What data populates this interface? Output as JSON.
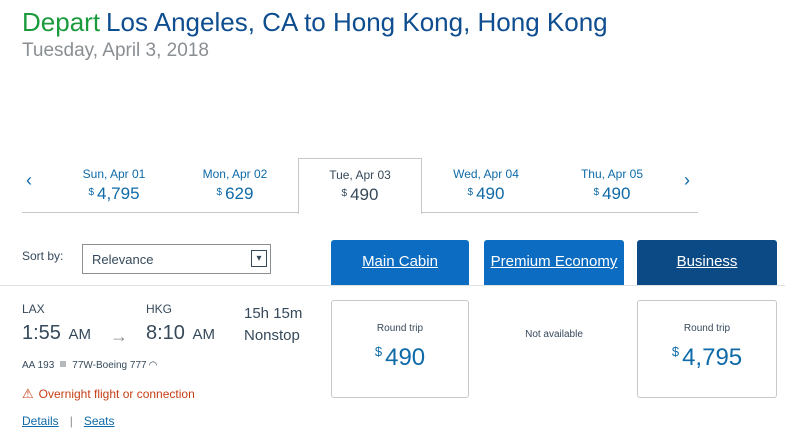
{
  "header": {
    "depart_label": "Depart",
    "route": "Los Angeles, CA to Hong Kong, Hong Kong",
    "date": "Tuesday, April 3, 2018"
  },
  "date_bar": {
    "prev_icon": "chevron-left-icon",
    "next_icon": "chevron-right-icon",
    "prev_glyph": "‹",
    "next_glyph": "›",
    "days": [
      {
        "label": "Sun, Apr 01",
        "currency": "$",
        "price": "4,795",
        "active": false
      },
      {
        "label": "Mon, Apr 02",
        "currency": "$",
        "price": "629",
        "active": false
      },
      {
        "label": "Tue, Apr 03",
        "currency": "$",
        "price": "490",
        "active": true
      },
      {
        "label": "Wed, Apr 04",
        "currency": "$",
        "price": "490",
        "active": false
      },
      {
        "label": "Thu, Apr 05",
        "currency": "$",
        "price": "490",
        "active": false
      }
    ]
  },
  "sort": {
    "label": "Sort by:",
    "selected": "Relevance",
    "dropdown_glyph": "▾"
  },
  "cabins": {
    "main": "Main Cabin",
    "premium": "Premium Economy",
    "business": "Business"
  },
  "flight": {
    "origin": "LAX",
    "destination": "HKG",
    "depart_time": "1:55",
    "depart_ampm": "AM",
    "arrive_time": "8:10",
    "arrive_ampm": "AM",
    "arrow_glyph": "→",
    "duration": "15h  15m",
    "stops": "Nonstop",
    "flight_number": "AA 193",
    "aircraft": "77W-Boeing 777",
    "wifi_glyph": "◠",
    "warning_glyph": "⚠",
    "warning": "Overnight flight or connection",
    "details_link": "Details",
    "seats_link": "Seats",
    "link_separator": "|"
  },
  "fares": {
    "main": {
      "type": "Round trip",
      "currency": "$",
      "price": "490"
    },
    "premium": {
      "status": "Not available"
    },
    "business": {
      "type": "Round trip",
      "currency": "$",
      "price": "4,795"
    }
  },
  "colors": {
    "depart_green": "#1c9b3d",
    "route_blue": "#0e4d8f",
    "link_blue": "#0e6aa8",
    "cabin_tab_blue": "#0c6cc1",
    "business_tab_navy": "#0b4a85",
    "warning_orange": "#c53e14"
  }
}
